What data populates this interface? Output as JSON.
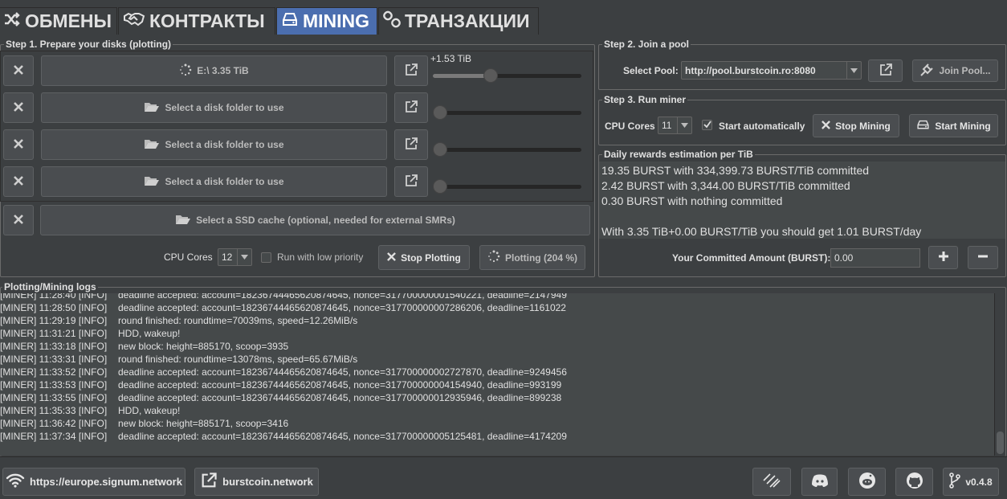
{
  "tabs": [
    {
      "label": "ОБМЕНЫ",
      "icon": "shuffle-icon"
    },
    {
      "label": "КОНТРАКТЫ",
      "icon": "handshake-icon"
    },
    {
      "label": "MINING",
      "icon": "hdd-icon",
      "active": true
    },
    {
      "label": "ТРАНЗАКЦИИ",
      "icon": "link-icon"
    }
  ],
  "step1": {
    "title": "Step 1. Prepare your disks (plotting)",
    "disks": [
      {
        "label": "E:\\ 3.35 TiB",
        "extra": "+1.53 TiB",
        "level": 0.38
      },
      {
        "label": "Select a disk folder to use",
        "extra": "",
        "level": 0
      },
      {
        "label": "Select a disk folder to use",
        "extra": "",
        "level": 0
      },
      {
        "label": "Select a disk folder to use",
        "extra": "",
        "level": 0
      }
    ],
    "ssd_label": "Select a SSD cache (optional, needed for external SMRs)",
    "cpu_cores_label": "CPU Cores",
    "cpu_cores_value": "12",
    "low_priority_label": "Run with low priority",
    "stop_plotting_label": "Stop Plotting",
    "plotting_status_label": "Plotting (204 %)"
  },
  "step2": {
    "title": "Step 2. Join a pool",
    "select_pool_label": "Select Pool:",
    "pool_value": "http://pool.burstcoin.ro:8080",
    "join_pool_label": "Join Pool..."
  },
  "step3": {
    "title": "Step 3. Run miner",
    "cpu_cores_label": "CPU Cores",
    "cpu_cores_value": "11",
    "start_auto_label": "Start automatically",
    "stop_mining_label": "Stop Mining",
    "start_mining_label": "Start Mining"
  },
  "rewards": {
    "title": "Daily rewards estimation per TiB",
    "text": "19.35 BURST with 334,399.73 BURST/TiB committed\n2.42 BURST with 3,344.00 BURST/TiB committed\n0.30 BURST with nothing committed\n\nWith 3.35 TiB+0.00 BURST/TiB you should get 1.01 BURST/day",
    "committed_label": "Your Committed Amount (BURST):",
    "committed_value": "0.00"
  },
  "logs": {
    "title": "Plotting/Mining logs",
    "lines": [
      {
        "prefix": "[MINER] 11:28:40 [INFO]",
        "msg": "deadline accepted: account=18236744465620874645, nonce=317700000001540221, deadline=2147949"
      },
      {
        "prefix": "[MINER] 11:28:50 [INFO]",
        "msg": "deadline accepted: account=18236744465620874645, nonce=317700000007286206, deadline=1161022"
      },
      {
        "prefix": "[MINER] 11:29:19 [INFO]",
        "msg": "round finished: roundtime=70039ms, speed=12.26MiB/s"
      },
      {
        "prefix": "[MINER] 11:31:21 [INFO]",
        "msg": "HDD, wakeup!"
      },
      {
        "prefix": "[MINER] 11:33:18 [INFO]",
        "msg": "new block: height=885170, scoop=3935"
      },
      {
        "prefix": "[MINER] 11:33:31 [INFO]",
        "msg": "round finished: roundtime=13078ms, speed=65.67MiB/s"
      },
      {
        "prefix": "[MINER] 11:33:52 [INFO]",
        "msg": "deadline accepted: account=18236744465620874645, nonce=317700000002727870, deadline=9249456"
      },
      {
        "prefix": "[MINER] 11:33:53 [INFO]",
        "msg": "deadline accepted: account=18236744465620874645, nonce=317700000004154940, deadline=993199"
      },
      {
        "prefix": "[MINER] 11:33:55 [INFO]",
        "msg": "deadline accepted: account=18236744465620874645, nonce=317700000012935946, deadline=899238"
      },
      {
        "prefix": "[MINER] 11:35:33 [INFO]",
        "msg": "HDD, wakeup!"
      },
      {
        "prefix": "[MINER] 11:36:42 [INFO]",
        "msg": "new block: height=885171, scoop=3416"
      },
      {
        "prefix": "[MINER] 11:37:34 [INFO]",
        "msg": "deadline accepted: account=18236744465620874645, nonce=317700000005125481, deadline=4174209"
      }
    ]
  },
  "footer": {
    "node_url": "https://europe.signum.network",
    "site_label": "burstcoin.network",
    "version": "v0.4.8"
  }
}
